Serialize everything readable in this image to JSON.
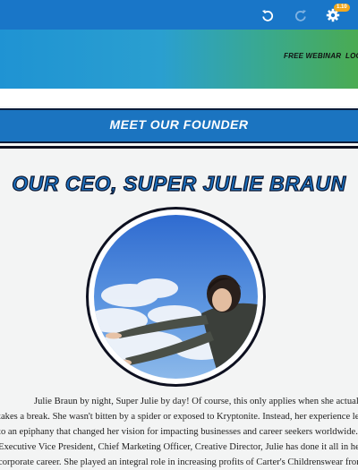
{
  "toolbar": {
    "badge": "1.10",
    "icons": [
      "undo-icon",
      "redo-icon",
      "gear-icon"
    ],
    "colors": {
      "bar": "#1976c8",
      "badge": "#f2a81d"
    }
  },
  "nav": {
    "free_webinar": "FREE WEBINAR",
    "login": "LOG"
  },
  "founder_section": {
    "title": "MEET OUR FOUNDER"
  },
  "ceo": {
    "heading": "OUR CEO, SUPER JULIE BRAUN",
    "portrait_icon": "flying-woman-portrait"
  },
  "bio": {
    "lines": [
      "Julie Braun by night, Super Julie by day! Of course, this only applies when she actually",
      "takes a break. She wasn't bitten by a spider or exposed to Kryptonite. Instead, her experience led",
      "to an epiphany that changed her vision for impacting businesses and career seekers worldwide. As",
      "Executive Vice President, Chief Marketing Officer, Creative Director, Julie has done it all in her",
      "corporate career. She played an integral role in increasing profits of Carter's Childrenswear from"
    ]
  }
}
